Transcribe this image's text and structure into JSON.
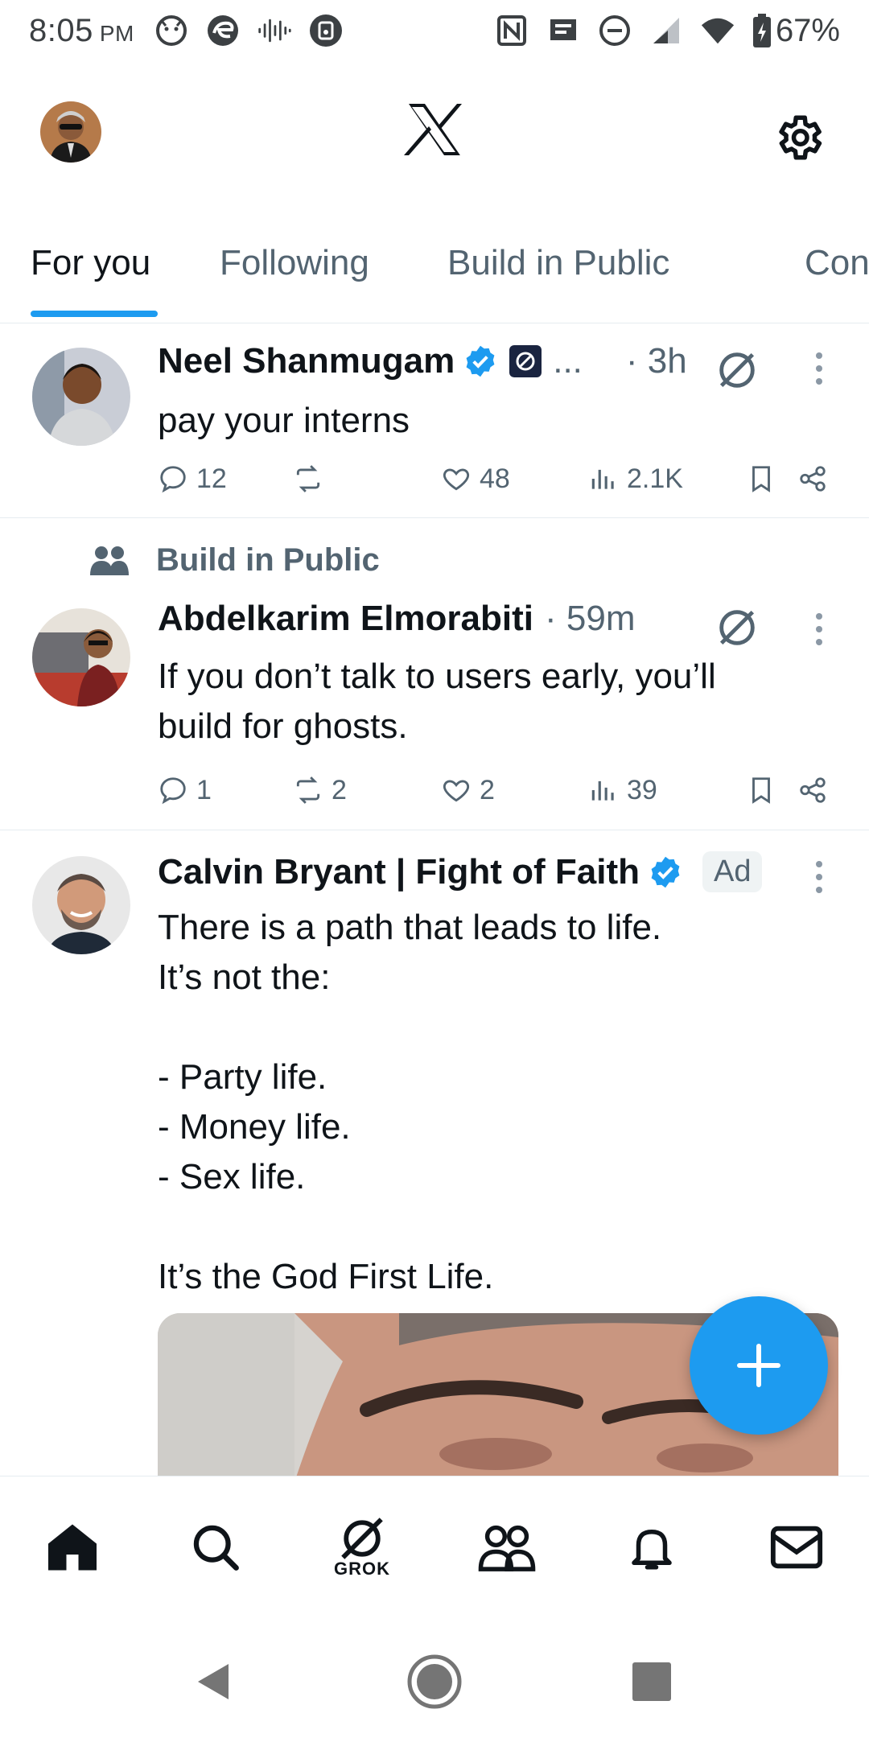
{
  "status_bar": {
    "time": "8:05",
    "ampm": "PM",
    "battery": "67%"
  },
  "header": {
    "logo": "X"
  },
  "tabs": [
    {
      "label": "For you",
      "active": true
    },
    {
      "label": "Following"
    },
    {
      "label": "Build in Public"
    },
    {
      "label": "Con"
    }
  ],
  "posts": [
    {
      "author": "Neel Shanmugam",
      "verified": true,
      "affiliation_ellipsis": "...",
      "time": "· 3h",
      "text": "pay your interns",
      "replies": "12",
      "reposts": "",
      "likes": "48",
      "views": "2.1K"
    },
    {
      "social_context": "Build in Public",
      "author": "Abdelkarim Elmorabiti",
      "time": "· 59m",
      "text": "If you don’t talk to users early, you’ll\nbuild for ghosts.",
      "replies": "1",
      "reposts": "2",
      "likes": "2",
      "views": "39"
    },
    {
      "author": "Calvin Bryant | Fight of Faith",
      "verified": true,
      "badge": "Ad",
      "text": "There is a path that leads to life.\nIt’s not the:\n\n- Party life.\n- Money life.\n- Sex life.\n\nIt’s the God First Life."
    }
  ],
  "bottom_nav": {
    "grok_label": "GROK"
  },
  "colors": {
    "accent": "#1d9bf0",
    "muted": "#536471",
    "text": "#0f1419"
  }
}
